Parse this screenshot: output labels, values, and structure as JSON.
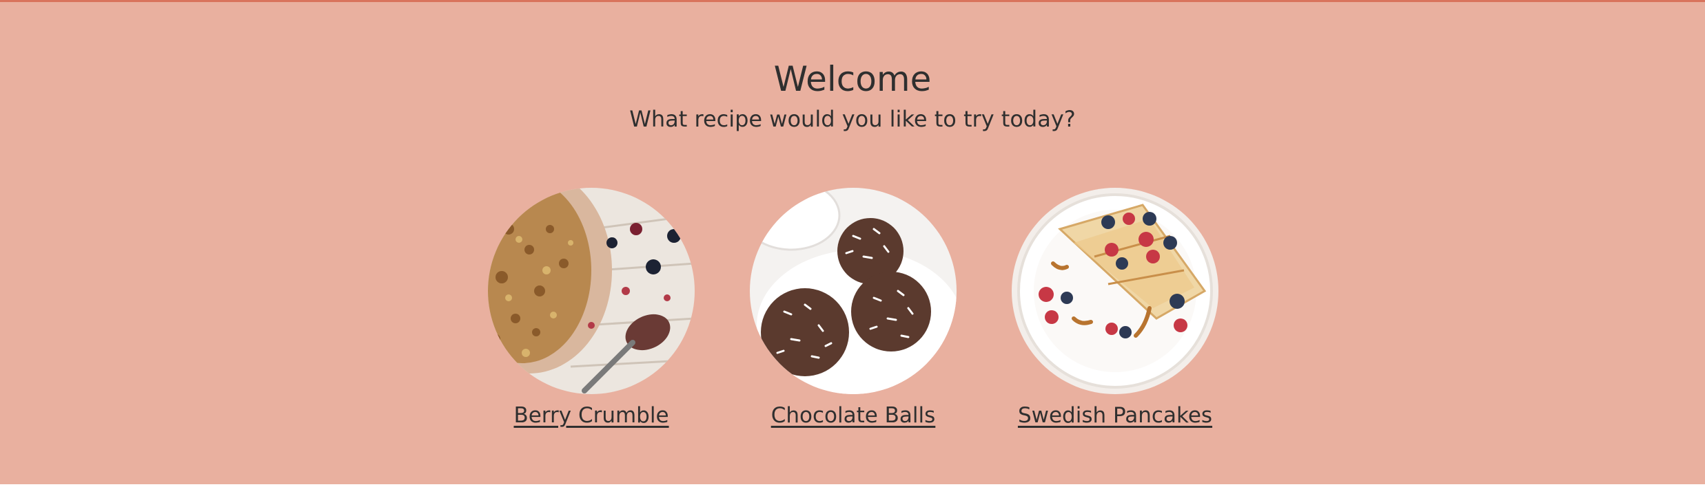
{
  "header": {
    "title": "Welcome",
    "subtitle": "What recipe would you like to try today?"
  },
  "recipes": [
    {
      "label": "Berry Crumble",
      "image": "berry-crumble-photo"
    },
    {
      "label": "Chocolate Balls",
      "image": "chocolate-balls-photo"
    },
    {
      "label": "Swedish Pancakes",
      "image": "swedish-pancakes-photo"
    }
  ],
  "colors": {
    "background": "#e9b09f",
    "top_border": "#d9735c",
    "text": "#2f2f2f"
  }
}
